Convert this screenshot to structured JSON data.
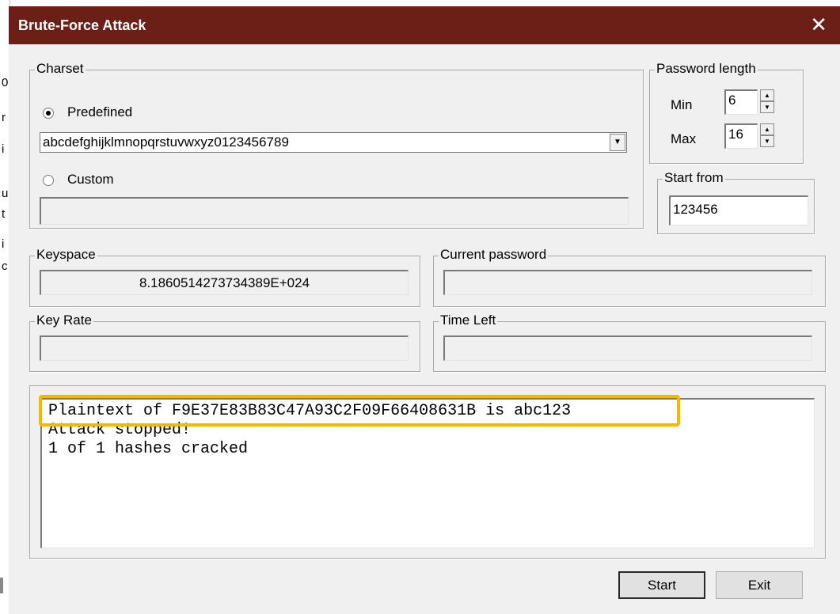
{
  "window": {
    "title": "Brute-Force Attack",
    "close_glyph": "✕"
  },
  "background_left_chars": [
    "0",
    "r",
    "i",
    "u",
    "t",
    "i",
    "c"
  ],
  "charset": {
    "legend": "Charset",
    "predefined_label": "Predefined",
    "predefined_value": "abcdefghijklmnopqrstuvwxyz0123456789",
    "custom_label": "Custom",
    "custom_value": "",
    "dropdown_glyph": "▼"
  },
  "password_length": {
    "legend": "Password length",
    "min_label": "Min",
    "min_value": "6",
    "max_label": "Max",
    "max_value": "16"
  },
  "start_from": {
    "legend": "Start from",
    "value": "123456"
  },
  "keyspace": {
    "legend": "Keyspace",
    "value": "8.1860514273734389E+024"
  },
  "current_password": {
    "legend": "Current password",
    "value": ""
  },
  "key_rate": {
    "legend": "Key Rate",
    "value": ""
  },
  "time_left": {
    "legend": "Time Left",
    "value": ""
  },
  "log": {
    "lines": [
      "Plaintext of F9E37E83B83C47A93C2F09F66408631B is abc123",
      "Attack stopped!",
      "1 of 1 hashes cracked"
    ],
    "highlight_color": "#f5b800"
  },
  "buttons": {
    "start": "Start",
    "exit": "Exit"
  },
  "colors": {
    "titlebar": "#6b1f16",
    "window_bg": "#f0f0f0"
  }
}
